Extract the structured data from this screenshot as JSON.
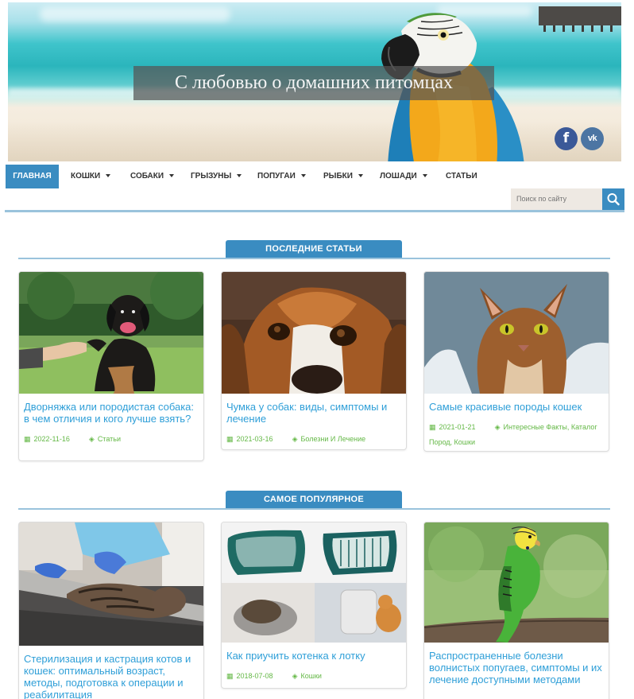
{
  "header": {
    "site_title": "С любовью о домашних питомцах",
    "social": {
      "facebook": "f",
      "vk": "vk"
    }
  },
  "nav": {
    "items": [
      {
        "label": "ГЛАВНАЯ",
        "active": true,
        "dropdown": false
      },
      {
        "label": "КОШКИ",
        "dropdown": true
      },
      {
        "label": "СОБАКИ",
        "dropdown": true
      },
      {
        "label": "ГРЫЗУНЫ",
        "dropdown": true
      },
      {
        "label": "ПОПУГАИ",
        "dropdown": true
      },
      {
        "label": "РЫБКИ",
        "dropdown": true
      },
      {
        "label": "ЛОШАДИ",
        "dropdown": true
      },
      {
        "label": "СТАТЬИ",
        "dropdown": false
      }
    ],
    "search_placeholder": "Поиск по сайту"
  },
  "sections": {
    "latest": {
      "heading": "ПОСЛЕДНИЕ СТАТЬИ",
      "cards": [
        {
          "title": "Дворняжка или породистая собака: в чем отличия и кого лучше взять?",
          "date": "2022-11-16",
          "category": "Статьи"
        },
        {
          "title": "Чумка у собак: виды, симптомы и лечение",
          "date": "2021-03-16",
          "category": "Болезни И Лечение"
        },
        {
          "title": "Самые красивые породы кошек",
          "date": "2021-01-21",
          "category": "Интересные Факты, Каталог Пород, Кошки"
        }
      ]
    },
    "popular": {
      "heading": "САМОЕ ПОПУЛЯРНОЕ",
      "cards": [
        {
          "title": "Стерилизация и кастрация котов и кошек: оптимальный возраст, методы, подготовка к операции и реабилитация"
        },
        {
          "title": "Как приучить котенка к лотку",
          "date": "2018-07-08",
          "category": "Кошки"
        },
        {
          "title": "Распространенные болезни волнистых попугаев, симптомы и их лечение доступными методами"
        }
      ]
    }
  },
  "colors": {
    "accent": "#3a8cc1",
    "link": "#2f9fd8",
    "meta": "#64b846",
    "divider": "#9ac3dc"
  }
}
